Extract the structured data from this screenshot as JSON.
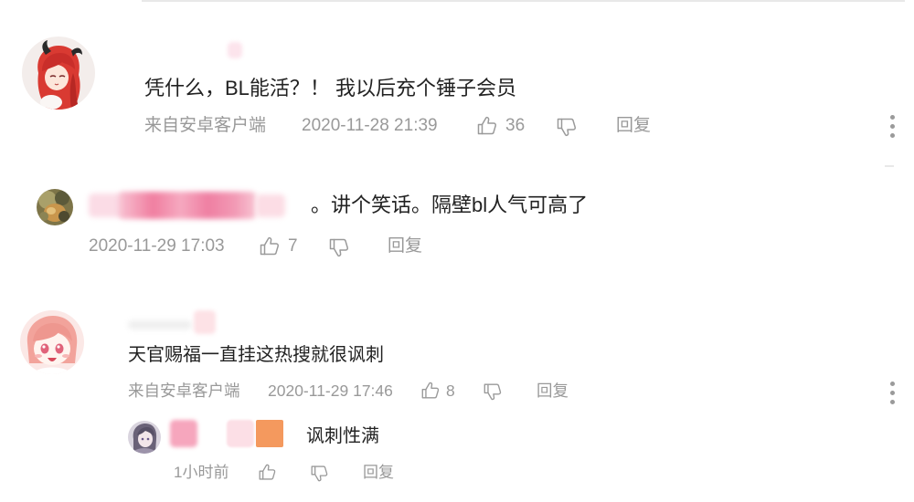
{
  "colors": {
    "text": "#222222",
    "meta": "#999999",
    "icon": "#9a9a9a",
    "divider": "#e8e8e8"
  },
  "icons": {
    "like": "thumbs-up-icon",
    "dislike": "thumbs-down-icon",
    "more": "more-vertical-icon"
  },
  "comments": [
    {
      "text": "凭什么，BL能活？！ 我以后充个锤子会员",
      "source": "来自安卓客户端",
      "time": "2020-11-28 21:39",
      "likes": "36",
      "reply_label": "回复"
    },
    {
      "text": "。讲个笑话。隔壁bl人气可高了",
      "time": "2020-11-29 17:03",
      "likes": "7",
      "reply_label": "回复"
    },
    {
      "text": "天官赐福一直挂这热搜就很讽刺",
      "source": "来自安卓客户端",
      "time": "2020-11-29 17:46",
      "likes": "8",
      "reply_label": "回复",
      "replies": [
        {
          "text": "讽刺性满",
          "time": "1小时前",
          "reply_label": "回复"
        }
      ]
    }
  ]
}
